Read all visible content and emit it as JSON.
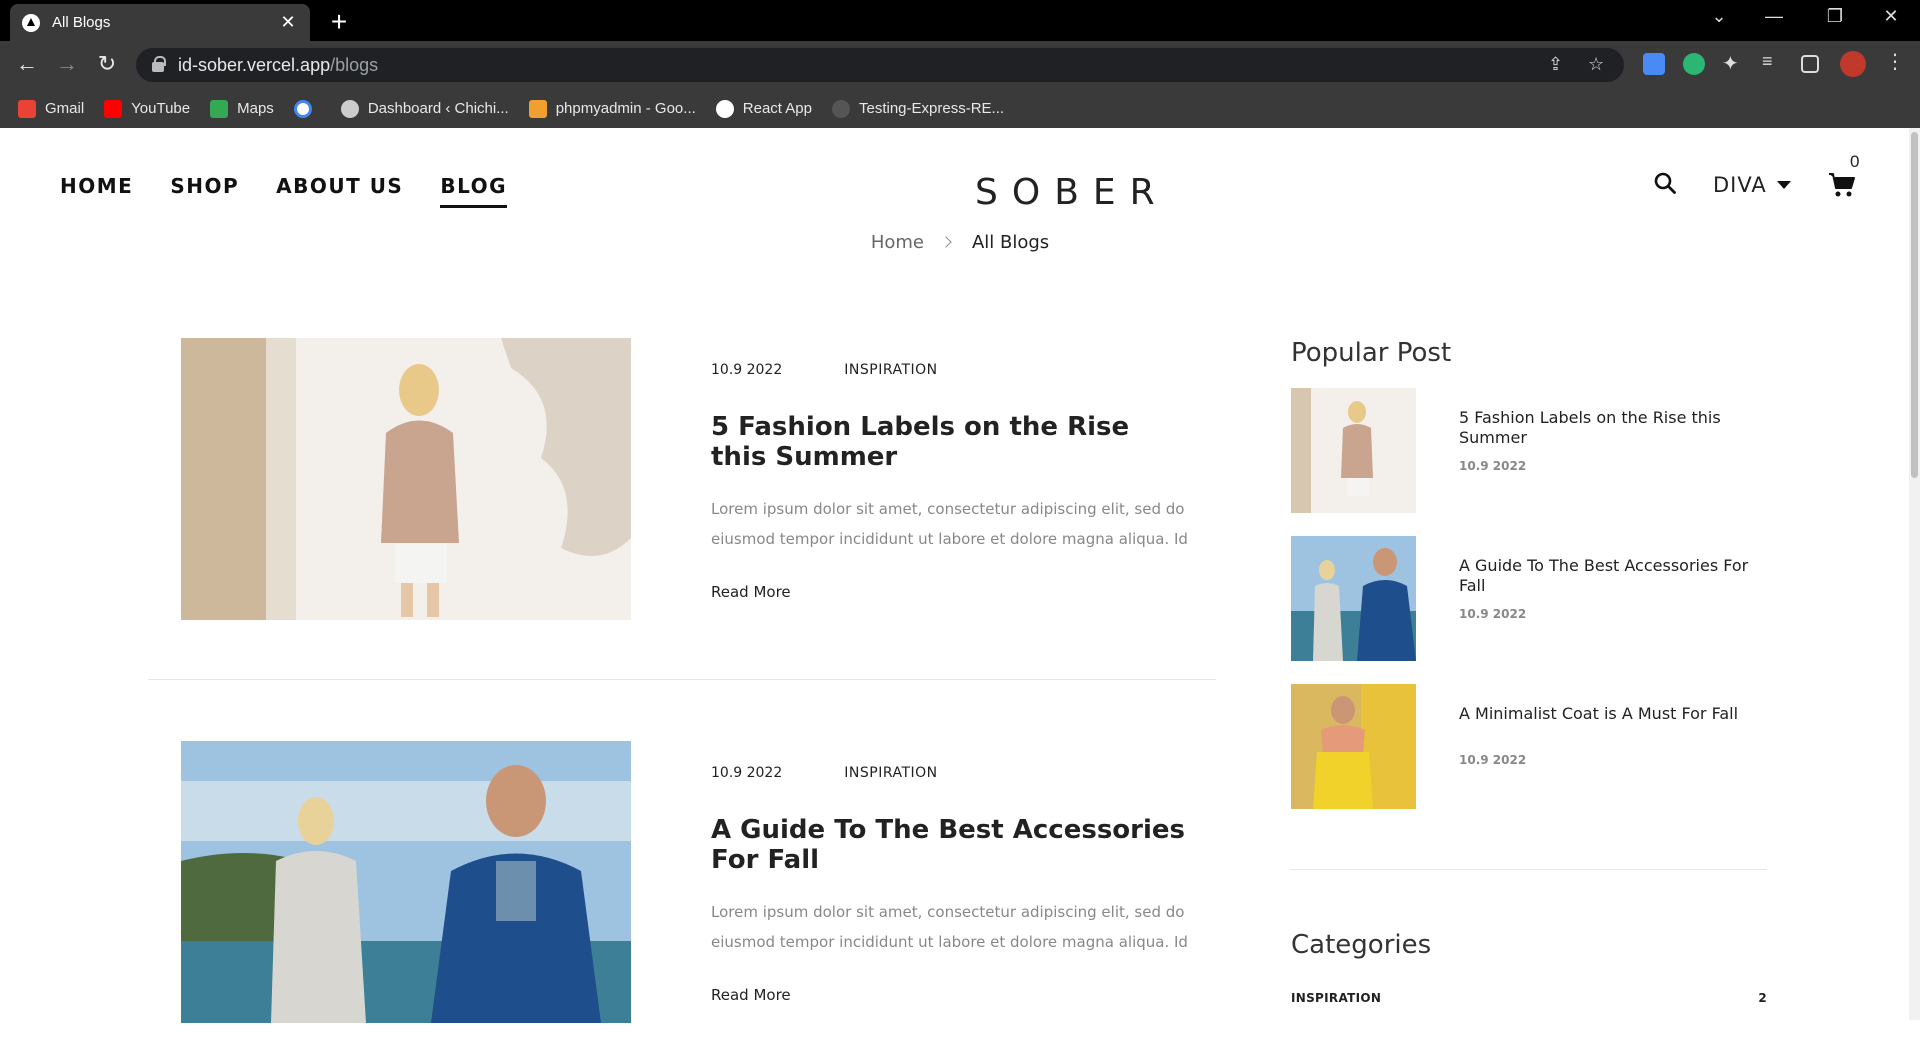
{
  "browser": {
    "tab_title": "All Blogs",
    "tab_close": "✕",
    "new_tab": "+",
    "url_host": "id-sober.vercel.app",
    "url_path": "/blogs",
    "bookmarks": [
      {
        "label": "Gmail",
        "icon": "gmail-icon",
        "color": "#ea4335"
      },
      {
        "label": "YouTube",
        "icon": "youtube-icon",
        "color": "#ff0000"
      },
      {
        "label": "Maps",
        "icon": "maps-icon",
        "color": "#34a853"
      },
      {
        "label": "",
        "icon": "google-icon",
        "color": "#4285f4"
      },
      {
        "label": "Dashboard ‹ Chichi...",
        "icon": "globe-icon",
        "color": "#cccccc"
      },
      {
        "label": "phpmyadmin - Goo...",
        "icon": "phpmyadmin-icon",
        "color": "#f0a030"
      },
      {
        "label": "React App",
        "icon": "react-app-icon",
        "color": "#ffffff"
      },
      {
        "label": "Testing-Express-RE...",
        "icon": "github-icon",
        "color": "#555555"
      }
    ]
  },
  "site": {
    "nav": [
      {
        "label": "HOME",
        "active": false
      },
      {
        "label": "SHOP",
        "active": false
      },
      {
        "label": "ABOUT US",
        "active": false
      },
      {
        "label": "BLOG",
        "active": true
      }
    ],
    "logo": "SOBER",
    "currency": "DIVA",
    "cart_count": "0",
    "breadcrumb": {
      "home": "Home",
      "current": "All Blogs"
    }
  },
  "posts": [
    {
      "date": "10.9 2022",
      "category": "INSPIRATION",
      "title": "5 Fashion Labels on the Rise this Summer",
      "excerpt": "Lorem ipsum dolor sit amet, consectetur adipiscing elit, sed do eiusmod tempor incididunt ut labore et dolore magna aliqua. Id",
      "read_more": "Read More"
    },
    {
      "date": "10.9 2022",
      "category": "INSPIRATION",
      "title": "A Guide To The Best Accessories For Fall",
      "excerpt": "Lorem ipsum dolor sit amet, consectetur adipiscing elit, sed do eiusmod tempor incididunt ut labore et dolore magna aliqua. Id",
      "read_more": "Read More"
    }
  ],
  "sidebar": {
    "popular_heading": "Popular Post",
    "popular": [
      {
        "title": "5 Fashion Labels on the Rise this Summer",
        "date": "10.9 2022"
      },
      {
        "title": "A Guide To The Best Accessories For Fall",
        "date": "10.9 2022"
      },
      {
        "title": "A Minimalist Coat is A Must For Fall",
        "date": "10.9 2022"
      }
    ],
    "categories_heading": "Categories",
    "categories": [
      {
        "name": "INSPIRATION",
        "count": "2"
      }
    ]
  }
}
